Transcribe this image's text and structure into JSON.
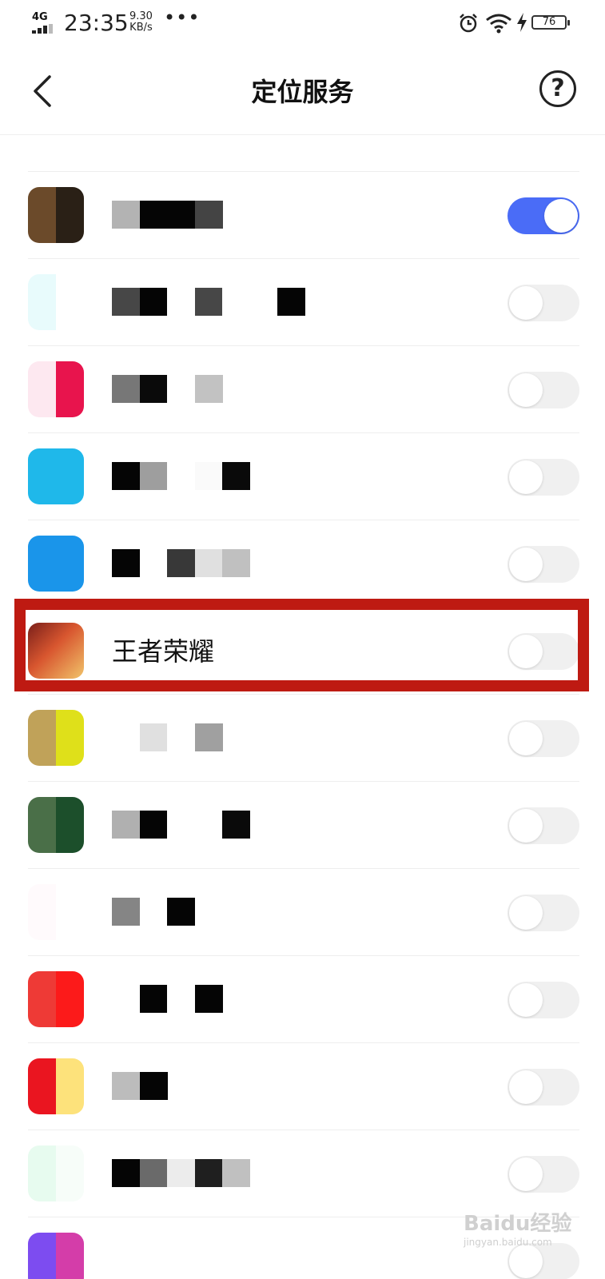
{
  "status_bar": {
    "network": "4G",
    "time": "23:35",
    "speed_value": "9.30",
    "speed_unit": "KB/s",
    "more": "•••",
    "battery": "76"
  },
  "header": {
    "title": "定位服务",
    "help": "?"
  },
  "apps": [
    {
      "label": "",
      "enabled": true,
      "icon_colors": [
        "#6b4a2a",
        "#2a2016"
      ],
      "name_blocks": [
        "#b3b3b3",
        "#050505",
        "#050505",
        "#444444"
      ]
    },
    {
      "label": "",
      "enabled": false,
      "icon_colors": [
        "#e8fbfc",
        "#ffffff"
      ],
      "name_blocks": [
        "#474747",
        "#050505",
        "#ffffff",
        "#474747",
        "#ffffff",
        "#ffffff",
        "#050505"
      ]
    },
    {
      "label": "",
      "enabled": false,
      "icon_colors": [
        "#fde8f0",
        "#e8144d"
      ],
      "name_blocks": [
        "#777777",
        "#0a0a0a",
        "#ffffff",
        "#c2c2c2"
      ]
    },
    {
      "label": "",
      "enabled": false,
      "icon_colors": [
        "#1fb8ea",
        "#1fb8ea"
      ],
      "name_blocks": [
        "#050505",
        "#9e9e9e",
        "#ffffff",
        "#fafafa",
        "#0a0a0a"
      ]
    },
    {
      "label": "",
      "enabled": false,
      "icon_colors": [
        "#1a95ea",
        "#1a95ea"
      ],
      "name_blocks": [
        "#050505",
        "#ffffff",
        "#383838",
        "#e0e0e0",
        "#c0c0c0"
      ]
    },
    {
      "label": "王者荣耀",
      "enabled": false,
      "icon_colors": [
        "#c8412a",
        "#e8b04a"
      ],
      "name_blocks": []
    },
    {
      "label": "",
      "enabled": false,
      "icon_colors": [
        "#c0a259",
        "#dfe01a"
      ],
      "name_blocks": [
        "#ffffff",
        "#e0e0e0",
        "#ffffff",
        "#a0a0a0"
      ]
    },
    {
      "label": "",
      "enabled": false,
      "icon_colors": [
        "#4a6f48",
        "#1c4f2b"
      ],
      "name_blocks": [
        "#b0b0b0",
        "#050505",
        "#ffffff",
        "#ffffff",
        "#0a0a0a"
      ]
    },
    {
      "label": "",
      "enabled": false,
      "icon_colors": [
        "#fffafc",
        "#ffffff"
      ],
      "name_blocks": [
        "#858585",
        "#ffffff",
        "#050505"
      ]
    },
    {
      "label": "",
      "enabled": false,
      "icon_colors": [
        "#ee3a36",
        "#fc1a1a"
      ],
      "name_blocks": [
        "#ffffff",
        "#050505",
        "#ffffff",
        "#050505"
      ]
    },
    {
      "label": "",
      "enabled": false,
      "icon_colors": [
        "#ea1520",
        "#fde27b"
      ],
      "name_blocks": [
        "#bcbcbc",
        "#050505"
      ]
    },
    {
      "label": "",
      "enabled": false,
      "icon_colors": [
        "#e7fbef",
        "#f7fdf9"
      ],
      "name_blocks": [
        "#050505",
        "#6a6a6a",
        "#ececec",
        "#1f1f1f",
        "#c0c0c0"
      ]
    },
    {
      "label": "",
      "enabled": false,
      "icon_colors": [
        "#7d4cf0",
        "#d43da9"
      ],
      "name_blocks": []
    }
  ],
  "watermark": {
    "brand": "Baidu经验",
    "url": "jingyan.baidu.com"
  }
}
